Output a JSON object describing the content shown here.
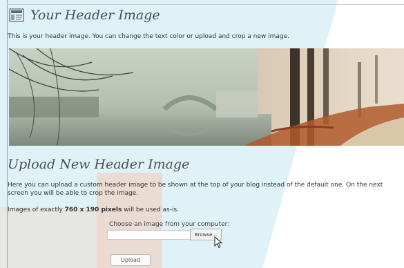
{
  "header_section": {
    "title": "Your Header Image",
    "description": "This is your header image. You can change the text color or upload and crop a new image."
  },
  "upload_section": {
    "title": "Upload New Header Image",
    "instructions": "Here you can upload a custom header image to be shown at the top of your blog instead of the default one. On the next screen you will be able to crop the image.",
    "size_note_prefix": "Images of exactly ",
    "size_note_bold": "760 x 190 pixels",
    "size_note_suffix": " will be used as-is.",
    "choose_label": "Choose an image from your computer:",
    "file_value": "",
    "browse_label": "Browse...",
    "upload_label": "Upload"
  },
  "icons": {
    "title_icon": "header-image-icon",
    "cursor": "mouse-pointer-icon"
  },
  "colors": {
    "overlay_blue": "#d3edf6",
    "overlay_orange": "#f4c9b4",
    "heading_text": "#4d4d4d"
  }
}
